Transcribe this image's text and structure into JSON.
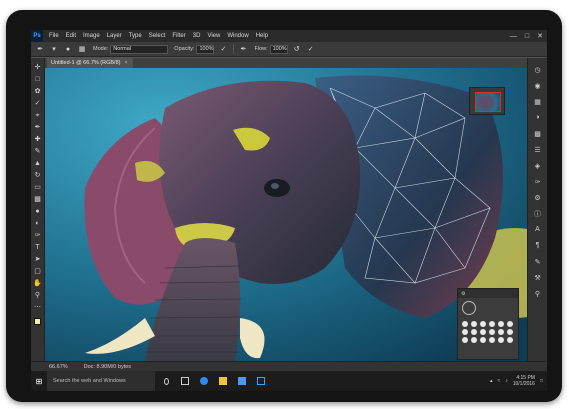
{
  "app": {
    "logo": "Ps",
    "menu": [
      "File",
      "Edit",
      "Image",
      "Layer",
      "Type",
      "Select",
      "Filter",
      "3D",
      "View",
      "Window",
      "Help"
    ],
    "window_controls": [
      "minimize-icon",
      "maximize-icon",
      "close-icon"
    ]
  },
  "options_bar": {
    "mode_label": "Mode:",
    "mode_value": "Normal",
    "opacity_label": "Opacity:",
    "opacity_value": "100%",
    "flow_label": "Flow:",
    "flow_value": "100%"
  },
  "document": {
    "tab_title": "Untitled-1 @ 66.7% (RGB/8)",
    "zoom": "66.67%",
    "doc_info": "Doc: 8.90M/0 bytes"
  },
  "tools": [
    "move-icon",
    "marquee-icon",
    "lasso-icon",
    "quick-select-icon",
    "crop-icon",
    "eyedropper-icon",
    "healing-icon",
    "brush-icon",
    "stamp-icon",
    "history-brush-icon",
    "eraser-icon",
    "gradient-icon",
    "blur-icon",
    "dodge-icon",
    "pen-icon",
    "type-icon",
    "path-select-icon",
    "shape-icon",
    "hand-icon",
    "zoom-icon"
  ],
  "colors": {
    "foreground": "#f1ef9f",
    "ps_blue": "#31a8ff",
    "menubar": "#2b2b2b",
    "panel": "#333333",
    "workspace": "#535353"
  },
  "taskbar": {
    "search_placeholder": "Search the web and Windows",
    "clock_time": "4:15 PM",
    "clock_date": "10/1/2016"
  }
}
